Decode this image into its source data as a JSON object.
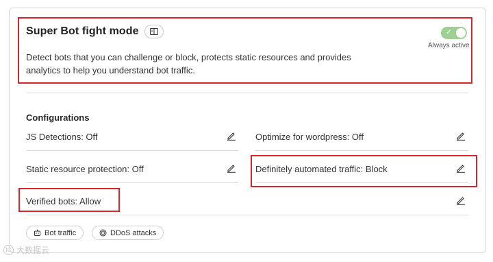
{
  "header": {
    "title": "Super Bot fight mode",
    "toggle_state": "on",
    "toggle_label": "Always active",
    "description": "Detect bots that you can challenge or block, protects static resources and provides analytics to help you understand bot traffic."
  },
  "configurations": {
    "label": "Configurations",
    "items": [
      {
        "label": "JS Detections: Off"
      },
      {
        "label": "Optimize for wordpress: Off"
      },
      {
        "label": "Static resource protection: Off"
      },
      {
        "label": "Definitely automated traffic: Block"
      },
      {
        "label": "Verified bots: Allow"
      }
    ]
  },
  "chips": [
    {
      "label": "Bot traffic",
      "icon": "bot-icon"
    },
    {
      "label": "DDoS attacks",
      "icon": "target-icon"
    }
  ],
  "watermark": {
    "text": "大数据云"
  },
  "colors": {
    "highlight": "#d9232e",
    "toggle_on": "#9fcf92",
    "border": "#d9d9d9"
  }
}
